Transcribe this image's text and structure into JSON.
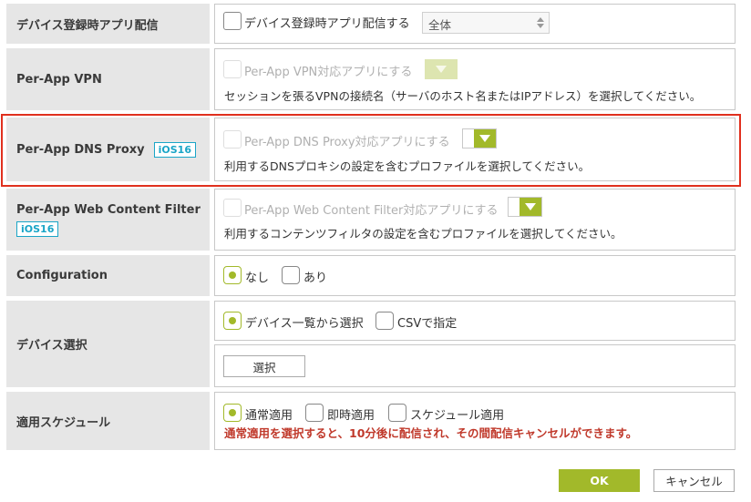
{
  "rows": {
    "row1": {
      "label": "デバイス登録時アプリ配信",
      "checkbox_label": "デバイス登録時アプリ配信する",
      "select_value": "全体"
    },
    "row2": {
      "label": "Per-App VPN",
      "checkbox_label": "Per-App VPN対応アプリにする",
      "help": "セッションを張るVPNの接続名（サーバのホスト名またはIPアドレス）を選択してください。"
    },
    "row3": {
      "label": "Per-App DNS Proxy",
      "badge": "iOS16",
      "checkbox_label": "Per-App DNS Proxy対応アプリにする",
      "help": "利用するDNSプロキシの設定を含むプロファイルを選択してください。"
    },
    "row4": {
      "label": "Per-App Web Content Filter",
      "badge": "iOS16",
      "checkbox_label": "Per-App Web Content Filter対応アプリにする",
      "help": "利用するコンテンツフィルタの設定を含むプロファイルを選択してください。"
    },
    "row5": {
      "label": "Configuration",
      "option_none": "なし",
      "option_yes": "あり",
      "selected": "なし"
    },
    "row6": {
      "label": "デバイス選択",
      "option_list": "デバイス一覧から選択",
      "option_csv": "CSVで指定",
      "selected": "デバイス一覧から選択",
      "select_button": "選択"
    },
    "row7": {
      "label": "適用スケジュール",
      "option_normal": "通常適用",
      "option_immediate": "即時適用",
      "option_schedule": "スケジュール適用",
      "selected": "通常適用",
      "warning": "通常適用を選択すると、10分後に配信され、その間配信キャンセルができます。"
    }
  },
  "footer": {
    "ok": "OK",
    "cancel": "キャンセル"
  },
  "colors": {
    "accent": "#a2b92a",
    "badge": "#1aa5c7",
    "warning": "#c0392b",
    "highlight": "#e0301e"
  }
}
